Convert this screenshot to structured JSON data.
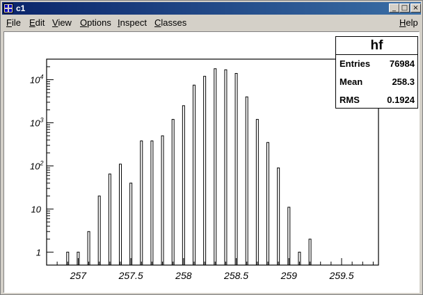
{
  "window": {
    "title": "c1",
    "buttons": {
      "minimize": "_",
      "maximize": "□",
      "close": "×"
    }
  },
  "menu": {
    "items": [
      {
        "label": "File",
        "underline": "F",
        "rest": "ile"
      },
      {
        "label": "Edit",
        "underline": "E",
        "rest": "dit"
      },
      {
        "label": "View",
        "underline": "V",
        "rest": "iew"
      },
      {
        "label": "Options",
        "underline": "O",
        "rest": "ptions"
      },
      {
        "label": "Inspect",
        "underline": "I",
        "rest": "nspect"
      },
      {
        "label": "Classes",
        "underline": "C",
        "rest": "lasses"
      }
    ],
    "help": {
      "label": "Help",
      "underline": "H",
      "rest": "elp"
    }
  },
  "stats": {
    "title": "hf",
    "rows": [
      {
        "key": "Entries",
        "value": "76984"
      },
      {
        "key": "Mean",
        "value": "258.3"
      },
      {
        "key": "RMS",
        "value": "0.1924"
      }
    ]
  },
  "chart_data": {
    "type": "bar",
    "title": "",
    "xlabel": "",
    "ylabel": "",
    "x_scale": "linear",
    "y_scale": "log",
    "xlim": [
      256.7,
      259.85
    ],
    "ylim": [
      0.5,
      30000
    ],
    "x_ticks": [
      "257",
      "257.5",
      "258",
      "258.5",
      "259",
      "259.5"
    ],
    "x_tick_values": [
      257,
      257.5,
      258,
      258.5,
      259,
      259.5
    ],
    "y_ticks": [
      {
        "value": 1,
        "label": "1",
        "sup": ""
      },
      {
        "value": 10,
        "label": "10",
        "sup": ""
      },
      {
        "value": 100,
        "label": "10",
        "sup": "2"
      },
      {
        "value": 1000,
        "label": "10",
        "sup": "3"
      },
      {
        "value": 10000,
        "label": "10",
        "sup": "4"
      }
    ],
    "x": [
      256.9,
      257.0,
      257.1,
      257.2,
      257.3,
      257.4,
      257.5,
      257.6,
      257.7,
      257.8,
      257.9,
      258.0,
      258.1,
      258.2,
      258.3,
      258.4,
      258.5,
      258.6,
      258.7,
      258.8,
      258.9,
      259.0,
      259.1,
      259.2
    ],
    "values": [
      1,
      1,
      3,
      20,
      65,
      110,
      40,
      380,
      380,
      500,
      1200,
      2500,
      7500,
      12000,
      18000,
      17000,
      14000,
      4000,
      1200,
      350,
      90,
      11,
      1,
      2
    ],
    "grid": false,
    "legend": "none",
    "color": "#000000"
  }
}
